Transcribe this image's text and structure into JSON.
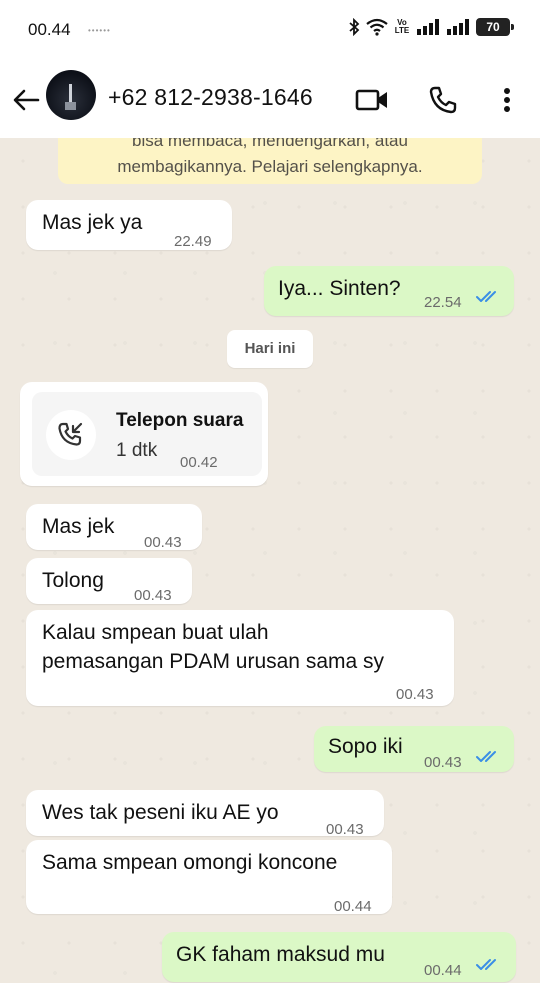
{
  "status_bar": {
    "time": "00.44",
    "dots": "••••••",
    "network_label": "Vo LTE",
    "battery": "70"
  },
  "header": {
    "contact": "+62 812-2938-1646"
  },
  "system_note": {
    "line1": "bisa membaca, mendengarkan, atau",
    "line2": "membagikannya. Pelajari selengkapnya."
  },
  "day_separator": "Hari ini",
  "call": {
    "title": "Telepon suara",
    "duration": "1 dtk",
    "time": "00.42"
  },
  "messages": [
    {
      "id": "m1",
      "direction": "in",
      "text": "Mas jek ya",
      "time": "22.49"
    },
    {
      "id": "m2",
      "direction": "out",
      "text": "Iya... Sinten?",
      "time": "22.54",
      "read": true
    },
    {
      "id": "m3",
      "direction": "in",
      "text": "Mas jek",
      "time": "00.43"
    },
    {
      "id": "m4",
      "direction": "in",
      "text": "Tolong",
      "time": "00.43"
    },
    {
      "id": "m5",
      "direction": "in",
      "text_line1": "Kalau smpean buat ulah",
      "text_line2": "pemasangan PDAM urusan sama sy",
      "time": "00.43"
    },
    {
      "id": "m6",
      "direction": "out",
      "text": "Sopo iki",
      "time": "00.43",
      "read": true
    },
    {
      "id": "m7",
      "direction": "in",
      "text": "Wes tak peseni iku AE yo",
      "time": "00.43"
    },
    {
      "id": "m8",
      "direction": "in",
      "text": "Sama smpean omongi koncone",
      "time": "00.44"
    },
    {
      "id": "m9",
      "direction": "out",
      "text": "GK faham maksud mu",
      "time": "00.44",
      "read": true
    }
  ],
  "colors": {
    "incoming_bubble": "#ffffff",
    "outgoing_bubble": "#dbf8c6",
    "read_ticks": "#3a8ee6",
    "chat_background": "#efe9e0",
    "system_note": "#fdf4c5"
  },
  "icons": [
    "back-arrow-icon",
    "video-call-icon",
    "phone-icon",
    "more-vert-icon",
    "incoming-call-icon",
    "bluetooth-icon",
    "wifi-icon",
    "signal-icon",
    "battery-icon",
    "double-check-icon"
  ]
}
